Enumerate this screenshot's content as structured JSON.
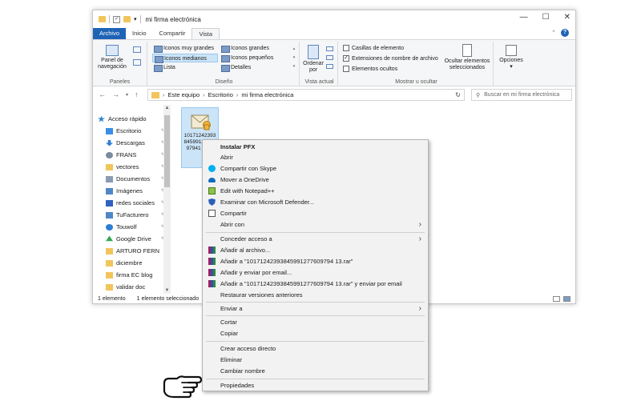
{
  "window": {
    "title": "mi firma electrónica",
    "controls": [
      "—",
      "☐",
      "✕"
    ]
  },
  "ribbon": {
    "tabs": [
      "Archivo",
      "Inicio",
      "Compartir",
      "Vista"
    ],
    "panel_nav_label": "Panel de navegación",
    "panes_group": "Paneles",
    "layout_options": [
      "Iconos muy grandes",
      "Iconos grandes",
      "Iconos medianos",
      "Iconos pequeños",
      "Lista",
      "Detalles"
    ],
    "layout_selected": "Iconos medianos",
    "layout_group": "Diseño",
    "sort_label": "Ordenar por",
    "current_view_group": "Vista actual",
    "checkboxes": [
      {
        "label": "Casillas de elemento",
        "checked": false
      },
      {
        "label": "Extensiones de nombre de archivo",
        "checked": true
      },
      {
        "label": "Elementos ocultos",
        "checked": false
      }
    ],
    "hide_selected_label": "Ocultar elementos seleccionados",
    "show_hide_group": "Mostrar u ocultar",
    "options_label": "Opciones"
  },
  "address": {
    "crumbs": [
      "Este equipo",
      "Escritorio",
      "mi firma electrónica"
    ],
    "search_placeholder": "Buscar en mi firma electrónica"
  },
  "nav": {
    "items": [
      {
        "label": "Acceso rápido",
        "color": "#2d7fd4"
      },
      {
        "label": "Escritorio",
        "color": "#3a8ee6"
      },
      {
        "label": "Descargas",
        "color": "#2d7fd4"
      },
      {
        "label": "FRANS",
        "color": "#7a8aa0"
      },
      {
        "label": "vectores",
        "color": "#f2c55c"
      },
      {
        "label": "Documentos",
        "color": "#8a9bb3"
      },
      {
        "label": "Imágenes",
        "color": "#4f86c8"
      },
      {
        "label": "redes sociales",
        "color": "#3060c0"
      },
      {
        "label": "TuFacturero",
        "color": "#4f86c8"
      },
      {
        "label": "Touwolf",
        "color": "#2d7fd4"
      },
      {
        "label": "Google Drive",
        "color": "#34a853"
      },
      {
        "label": "ARTURO FERN",
        "color": "#f2c55c"
      },
      {
        "label": "diciembre",
        "color": "#f2c55c"
      },
      {
        "label": "firma EC blog",
        "color": "#f2c55c"
      },
      {
        "label": "validar doc",
        "color": "#f2c55c"
      }
    ]
  },
  "file": {
    "name": "10171242393845991277609794 13.pfx",
    "display": "101712423938459912776097941 3.pfx"
  },
  "status": {
    "count": "1 elemento",
    "selected": "1 elemento seleccionado"
  },
  "context_menu": {
    "items": [
      {
        "label": "Instalar PFX",
        "bold": true,
        "icon": "none"
      },
      {
        "label": "Abrir",
        "icon": "none"
      },
      {
        "label": "Compartir con Skype",
        "icon": "skype-icon"
      },
      {
        "label": "Mover a OneDrive",
        "icon": "onedrive-icon"
      },
      {
        "label": "Edit with Notepad++",
        "icon": "notepad-icon"
      },
      {
        "label": "Examinar con Microsoft Defender...",
        "icon": "defender-icon"
      },
      {
        "label": "Compartir",
        "icon": "share-icon"
      },
      {
        "label": "Abrir con",
        "icon": "none",
        "submenu": true
      },
      {
        "label": "Conceder acceso a",
        "icon": "none",
        "submenu": true
      },
      {
        "label": "Añadir al archivo...",
        "icon": "winrar-icon"
      },
      {
        "label": "Añadir a \"10171242393845991277609794 13.rar\"",
        "icon": "winrar-icon"
      },
      {
        "label": "Añadir y enviar por email...",
        "icon": "winrar-icon"
      },
      {
        "label": "Añadir a \"10171242393845991277609794 13.rar\" y enviar por email",
        "icon": "winrar-icon"
      },
      {
        "label": "Restaurar versiones anteriores",
        "icon": "none"
      },
      {
        "label": "Enviar a",
        "icon": "none",
        "submenu": true
      },
      {
        "label": "Cortar",
        "icon": "none"
      },
      {
        "label": "Copiar",
        "icon": "none"
      },
      {
        "label": "Crear acceso directo",
        "icon": "none"
      },
      {
        "label": "Eliminar",
        "icon": "none"
      },
      {
        "label": "Cambiar nombre",
        "icon": "none"
      },
      {
        "label": "Propiedades",
        "icon": "none"
      }
    ]
  }
}
